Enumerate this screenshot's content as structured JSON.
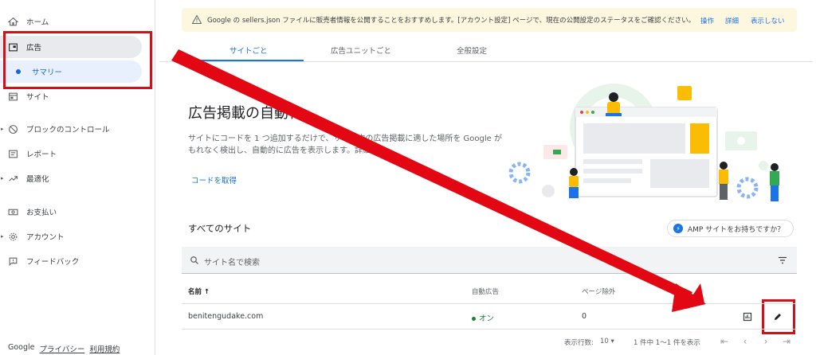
{
  "sidebar": {
    "items": [
      {
        "label": "ホーム",
        "icon": "home-icon"
      },
      {
        "label": "広告",
        "icon": "ads-icon"
      },
      {
        "label": "サマリー",
        "icon": "dot-icon"
      },
      {
        "label": "サイト",
        "icon": "sites-icon"
      },
      {
        "label": "ブロックのコントロール",
        "icon": "block-icon"
      },
      {
        "label": "レポート",
        "icon": "reports-icon"
      },
      {
        "label": "最適化",
        "icon": "optimize-icon"
      },
      {
        "label": "お支払い",
        "icon": "payments-icon"
      },
      {
        "label": "アカウント",
        "icon": "gear-icon"
      },
      {
        "label": "フィードバック",
        "icon": "feedback-icon"
      }
    ],
    "footer": {
      "brand": "Google",
      "privacy": "プライバシー",
      "terms": "利用規約"
    }
  },
  "banner": {
    "message": "Google の sellers.json ファイルに販売者情報を公開することをおすすめします。[アカウント設定] ページで、現在の公開設定のステータスをご確認ください。",
    "action1": "操作",
    "action2": "詳細",
    "action3": "表示しない"
  },
  "tabs": [
    {
      "label": "サイトごと"
    },
    {
      "label": "広告ユニットごと"
    },
    {
      "label": "全般設定"
    }
  ],
  "hero": {
    "title": "広告掲載の自動化",
    "description": "サイトにコードを 1 つ追加するだけで、サイト内の広告掲載に適した場所を Google がもれなく検出し、自動的に広告を表示します。詳細",
    "link": "コードを取得"
  },
  "sites": {
    "title": "すべてのサイト",
    "amp_chip": "AMP サイトをお持ちですか？",
    "search_placeholder": "サイト名で検索",
    "columns": {
      "name": "名前",
      "auto_ads": "自動広告",
      "page_exclusions": "ページ除外"
    },
    "rows": [
      {
        "name": "benitengudake.com",
        "status": "オン",
        "exclusions": "0"
      }
    ]
  },
  "pagination": {
    "rows_label": "表示行数:",
    "rows_value": "10",
    "range": "1 件中 1〜1 件を表示"
  },
  "colors": {
    "accent": "#1a73e8",
    "highlight": "#d0121b",
    "status": "#188038",
    "banner_bg": "#fef7e0"
  }
}
